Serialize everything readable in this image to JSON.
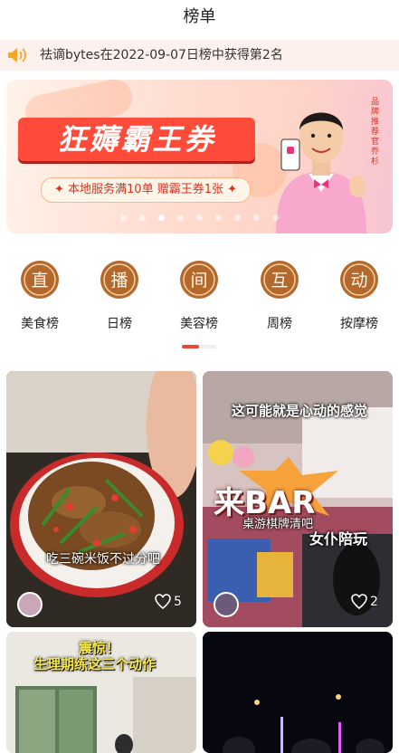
{
  "header": {
    "title": "榜单"
  },
  "notice": {
    "icon": "speaker-icon",
    "text": "祛谪bytes在2022-09-07日榜中获得第2名"
  },
  "banner": {
    "title": "狂薅霸王券",
    "subtitle": "✦ 本地服务满10单 赠霸王券1张 ✦",
    "side_text": "品牌推荐官 乔杉",
    "slide_count": 9,
    "active_slide": 2
  },
  "categories": [
    {
      "glyph": "直",
      "label": "美食榜"
    },
    {
      "glyph": "播",
      "label": "日榜"
    },
    {
      "glyph": "间",
      "label": "美容榜"
    },
    {
      "glyph": "互",
      "label": "周榜"
    },
    {
      "glyph": "动",
      "label": "按摩榜"
    }
  ],
  "category_page": {
    "current": 1,
    "total": 2
  },
  "cards": [
    {
      "caption": "吃三碗米饭不过分吧",
      "likes": "5"
    },
    {
      "caption_top": "这可能就是心动的感觉",
      "caption_mid": "来BAR",
      "caption_sub": "桌游棋牌清吧",
      "caption_tag": "女仆陪玩",
      "likes": "2"
    },
    {
      "caption_line1": "震惊！",
      "caption_line2": "生理期练这三个动作"
    },
    {}
  ],
  "colors": {
    "accent": "#f04438",
    "badge_brown": "#b5682c",
    "notice_bg": "#fdf1ee"
  }
}
